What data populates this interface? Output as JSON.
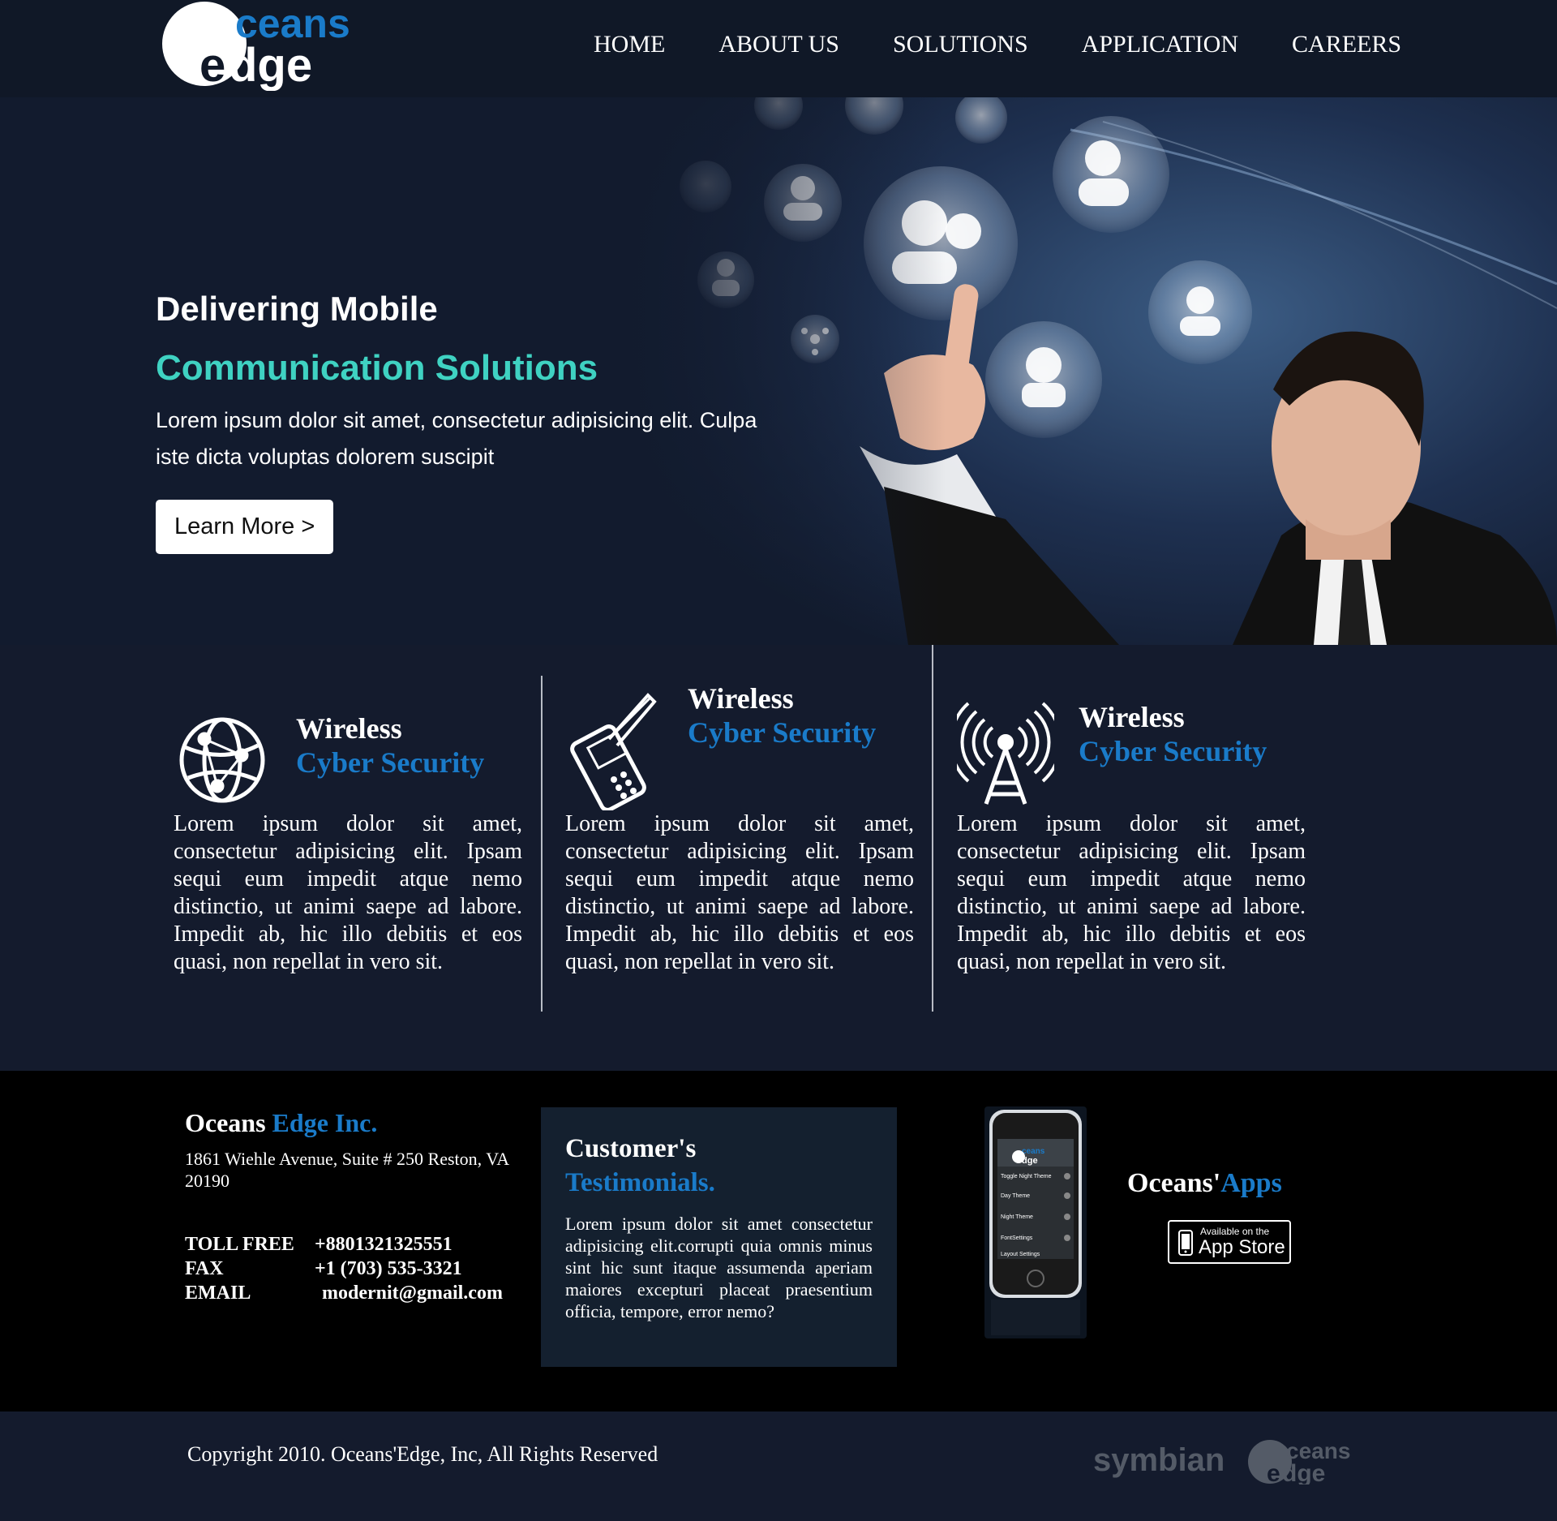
{
  "header": {
    "logo": {
      "top_text": "ceans",
      "bottom_text": "dge",
      "letter_e": "e",
      "brand_color": "#1a7bc9"
    },
    "nav": [
      "HOME",
      "ABOUT US",
      "SOLUTIONS",
      "APPLICATION",
      "CAREERS"
    ]
  },
  "hero": {
    "title_line1": "Delivering Mobile",
    "title_line2": "Communication Solutions",
    "description": "Lorem ipsum dolor sit amet, consectetur adipisicing elit. Culpa iste dicta voluptas dolorem suscipit",
    "button_label": "Learn More >",
    "accent_color": "#3fd2c2"
  },
  "features": [
    {
      "icon": "globe-network-icon",
      "title_line1": "Wireless",
      "title_line2": "Cyber Security",
      "body": "Lorem ipsum dolor sit amet, consectetur adipisicing elit. Ipsam sequi eum impedit atque nemo distinctio, ut animi saepe ad labore. Impedit ab, hic illo debitis et eos quasi, non repellat in vero sit."
    },
    {
      "icon": "mobile-phone-icon",
      "title_line1": "Wireless",
      "title_line2": "Cyber Security",
      "body": "Lorem ipsum dolor sit amet, consectetur adipisicing elit. Ipsam sequi eum impedit atque nemo distinctio, ut animi saepe ad labore. Impedit ab, hic illo debitis et eos quasi, non repellat in vero sit."
    },
    {
      "icon": "antenna-tower-icon",
      "title_line1": "Wireless",
      "title_line2": "Cyber Security",
      "body": "Lorem ipsum dolor sit amet, consectetur adipisicing elit. Ipsam sequi eum impedit atque nemo distinctio, ut animi saepe ad labore. Impedit ab, hic illo debitis et eos quasi, non repellat in vero sit."
    }
  ],
  "footer": {
    "company_name_white": "Oceans",
    "company_name_blue": "Edge Inc.",
    "address": "1861 Wiehle Avenue, Suite # 250 Reston, VA 20190",
    "contacts": [
      {
        "label": "TOLL FREE",
        "value": "+8801321325551"
      },
      {
        "label": "FAX",
        "value": "+1 (703) 535-3321"
      },
      {
        "label": "EMAIL",
        "value": "modernit@gmail.com"
      }
    ],
    "testimonials_title_white": "Customer's",
    "testimonials_title_blue": "Testimonials.",
    "testimonials_body": "Lorem ipsum dolor sit amet consectetur adipisicing elit.corrupti quia omnis minus sint hic sunt itaque assumenda aperiam maiores excepturi placeat praesentium officia, tempore, error nemo?",
    "apps_title_white": "Oceans'",
    "apps_title_blue": "Apps",
    "appstore_small": "Available on the",
    "appstore_big": "App Store",
    "phone_screen": {
      "logo_top": "ceans",
      "logo_bottom": "dge",
      "items": [
        "Toggle Night Theme",
        "Day Theme",
        "Night Theme",
        "FontSettings",
        "Layout Settings"
      ]
    }
  },
  "bottom": {
    "copyright": "Copyright 2010. Oceans'Edge, Inc, All Rights Reserved",
    "symbian": "symbian",
    "logo_small": {
      "top_text": "ceans",
      "bottom_text": "dge",
      "letter_e": "e"
    }
  }
}
